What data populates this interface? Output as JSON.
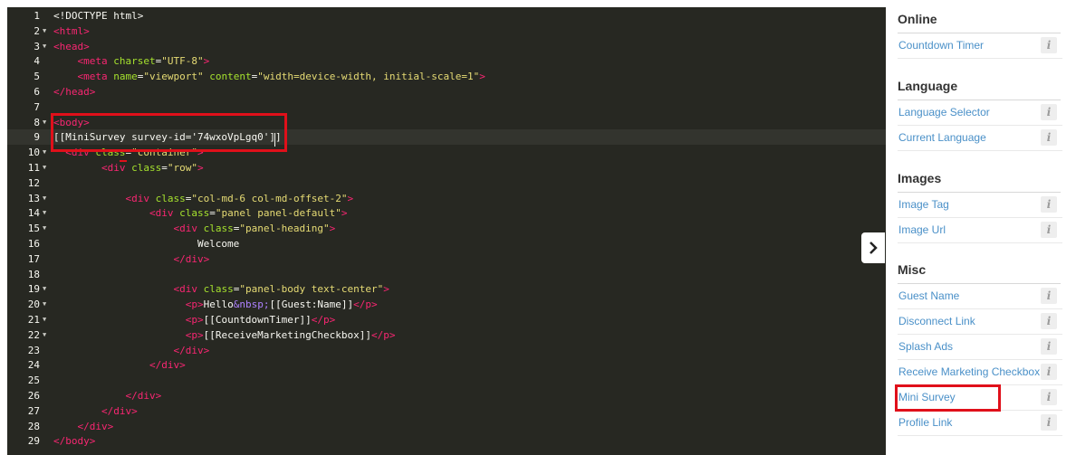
{
  "editor": {
    "lines": [
      {
        "n": "1",
        "fold": false,
        "segs": [
          {
            "c": "txt",
            "t": "<!DOCTYPE html>"
          }
        ]
      },
      {
        "n": "2",
        "fold": true,
        "segs": [
          {
            "c": "tg",
            "t": "<html>"
          }
        ]
      },
      {
        "n": "3",
        "fold": true,
        "segs": [
          {
            "c": "tg",
            "t": "<head>"
          }
        ]
      },
      {
        "n": "4",
        "fold": false,
        "segs": [
          {
            "c": "txt",
            "t": "    "
          },
          {
            "c": "tg",
            "t": "<meta "
          },
          {
            "c": "at",
            "t": "charset"
          },
          {
            "c": "txt",
            "t": "="
          },
          {
            "c": "st",
            "t": "\"UTF-8\""
          },
          {
            "c": "tg",
            "t": ">"
          }
        ]
      },
      {
        "n": "5",
        "fold": false,
        "segs": [
          {
            "c": "txt",
            "t": "    "
          },
          {
            "c": "tg",
            "t": "<meta "
          },
          {
            "c": "at",
            "t": "name"
          },
          {
            "c": "txt",
            "t": "="
          },
          {
            "c": "st",
            "t": "\"viewport\" "
          },
          {
            "c": "at",
            "t": "content"
          },
          {
            "c": "txt",
            "t": "="
          },
          {
            "c": "st",
            "t": "\"width=device-width, initial-scale=1\""
          },
          {
            "c": "tg",
            "t": ">"
          }
        ]
      },
      {
        "n": "6",
        "fold": false,
        "segs": [
          {
            "c": "tg",
            "t": "</head>"
          }
        ]
      },
      {
        "n": "7",
        "fold": false,
        "segs": []
      },
      {
        "n": "8",
        "fold": true,
        "segs": [
          {
            "c": "tg",
            "t": "<body>"
          }
        ]
      },
      {
        "n": "9",
        "fold": false,
        "segs": [
          {
            "c": "txt",
            "t": "[[MiniSurvey survey-id='74wxoVpLgq0']]"
          }
        ]
      },
      {
        "n": "10",
        "fold": true,
        "segs": [
          {
            "c": "txt",
            "t": "  "
          },
          {
            "c": "tg",
            "t": "<div "
          },
          {
            "c": "at",
            "t": "class"
          },
          {
            "c": "txt",
            "t": "="
          },
          {
            "c": "st",
            "t": "\"container\""
          },
          {
            "c": "tg",
            "t": ">"
          }
        ]
      },
      {
        "n": "11",
        "fold": true,
        "segs": [
          {
            "c": "txt",
            "t": "        "
          },
          {
            "c": "tg",
            "t": "<div "
          },
          {
            "c": "at",
            "t": "class"
          },
          {
            "c": "txt",
            "t": "="
          },
          {
            "c": "st",
            "t": "\"row\""
          },
          {
            "c": "tg",
            "t": ">"
          }
        ]
      },
      {
        "n": "12",
        "fold": false,
        "segs": []
      },
      {
        "n": "13",
        "fold": true,
        "segs": [
          {
            "c": "txt",
            "t": "            "
          },
          {
            "c": "tg",
            "t": "<div "
          },
          {
            "c": "at",
            "t": "class"
          },
          {
            "c": "txt",
            "t": "="
          },
          {
            "c": "st",
            "t": "\"col-md-6 col-md-offset-2\""
          },
          {
            "c": "tg",
            "t": ">"
          }
        ]
      },
      {
        "n": "14",
        "fold": true,
        "segs": [
          {
            "c": "txt",
            "t": "                "
          },
          {
            "c": "tg",
            "t": "<div "
          },
          {
            "c": "at",
            "t": "class"
          },
          {
            "c": "txt",
            "t": "="
          },
          {
            "c": "st",
            "t": "\"panel panel-default\""
          },
          {
            "c": "tg",
            "t": ">"
          }
        ]
      },
      {
        "n": "15",
        "fold": true,
        "segs": [
          {
            "c": "txt",
            "t": "                    "
          },
          {
            "c": "tg",
            "t": "<div "
          },
          {
            "c": "at",
            "t": "class"
          },
          {
            "c": "txt",
            "t": "="
          },
          {
            "c": "st",
            "t": "\"panel-heading\""
          },
          {
            "c": "tg",
            "t": ">"
          }
        ]
      },
      {
        "n": "16",
        "fold": false,
        "segs": [
          {
            "c": "txt",
            "t": "                        Welcome"
          }
        ]
      },
      {
        "n": "17",
        "fold": false,
        "segs": [
          {
            "c": "txt",
            "t": "                    "
          },
          {
            "c": "tg",
            "t": "</div>"
          }
        ]
      },
      {
        "n": "18",
        "fold": false,
        "segs": []
      },
      {
        "n": "19",
        "fold": true,
        "segs": [
          {
            "c": "txt",
            "t": "                    "
          },
          {
            "c": "tg",
            "t": "<div "
          },
          {
            "c": "at",
            "t": "class"
          },
          {
            "c": "txt",
            "t": "="
          },
          {
            "c": "st",
            "t": "\"panel-body text-center\""
          },
          {
            "c": "tg",
            "t": ">"
          }
        ]
      },
      {
        "n": "20",
        "fold": true,
        "segs": [
          {
            "c": "txt",
            "t": "                      "
          },
          {
            "c": "tg",
            "t": "<p>"
          },
          {
            "c": "txt",
            "t": "Hello"
          },
          {
            "c": "en",
            "t": "&nbsp;"
          },
          {
            "c": "txt",
            "t": "[[Guest:Name]]"
          },
          {
            "c": "tg",
            "t": "</p>"
          }
        ]
      },
      {
        "n": "21",
        "fold": true,
        "segs": [
          {
            "c": "txt",
            "t": "                      "
          },
          {
            "c": "tg",
            "t": "<p>"
          },
          {
            "c": "txt",
            "t": "[[CountdownTimer]]"
          },
          {
            "c": "tg",
            "t": "</p>"
          }
        ]
      },
      {
        "n": "22",
        "fold": true,
        "segs": [
          {
            "c": "txt",
            "t": "                      "
          },
          {
            "c": "tg",
            "t": "<p>"
          },
          {
            "c": "txt",
            "t": "[[ReceiveMarketingCheckbox]]"
          },
          {
            "c": "tg",
            "t": "</p>"
          }
        ]
      },
      {
        "n": "23",
        "fold": false,
        "segs": [
          {
            "c": "txt",
            "t": "                    "
          },
          {
            "c": "tg",
            "t": "</div>"
          }
        ]
      },
      {
        "n": "24",
        "fold": false,
        "segs": [
          {
            "c": "txt",
            "t": "                "
          },
          {
            "c": "tg",
            "t": "</div>"
          }
        ]
      },
      {
        "n": "25",
        "fold": false,
        "segs": []
      },
      {
        "n": "26",
        "fold": false,
        "segs": [
          {
            "c": "txt",
            "t": "            "
          },
          {
            "c": "tg",
            "t": "</div>"
          }
        ]
      },
      {
        "n": "27",
        "fold": false,
        "segs": [
          {
            "c": "txt",
            "t": "        "
          },
          {
            "c": "tg",
            "t": "</div>"
          }
        ]
      },
      {
        "n": "28",
        "fold": false,
        "segs": [
          {
            "c": "txt",
            "t": "    "
          },
          {
            "c": "tg",
            "t": "</div>"
          }
        ]
      },
      {
        "n": "29",
        "fold": false,
        "segs": [
          {
            "c": "tg",
            "t": "</body>"
          }
        ]
      }
    ]
  },
  "sidebar": {
    "sections": [
      {
        "title": "Online",
        "items": [
          {
            "label": "Countdown Timer"
          }
        ]
      },
      {
        "title": "Language",
        "items": [
          {
            "label": "Language Selector"
          },
          {
            "label": "Current Language"
          }
        ]
      },
      {
        "title": "Images",
        "items": [
          {
            "label": "Image Tag"
          },
          {
            "label": "Image Url"
          }
        ]
      },
      {
        "title": "Misc",
        "items": [
          {
            "label": "Guest Name"
          },
          {
            "label": "Disconnect Link"
          },
          {
            "label": "Splash Ads"
          },
          {
            "label": "Receive Marketing Checkbox"
          },
          {
            "label": "Mini Survey"
          },
          {
            "label": "Profile Link"
          }
        ]
      }
    ],
    "info_glyph": "i",
    "link_color": "#4a90c8"
  },
  "colors": {
    "editor_bg": "#272822",
    "tag": "#f92672",
    "attr": "#a6e22e",
    "string": "#e6db74",
    "highlight_border": "#e0101a"
  }
}
